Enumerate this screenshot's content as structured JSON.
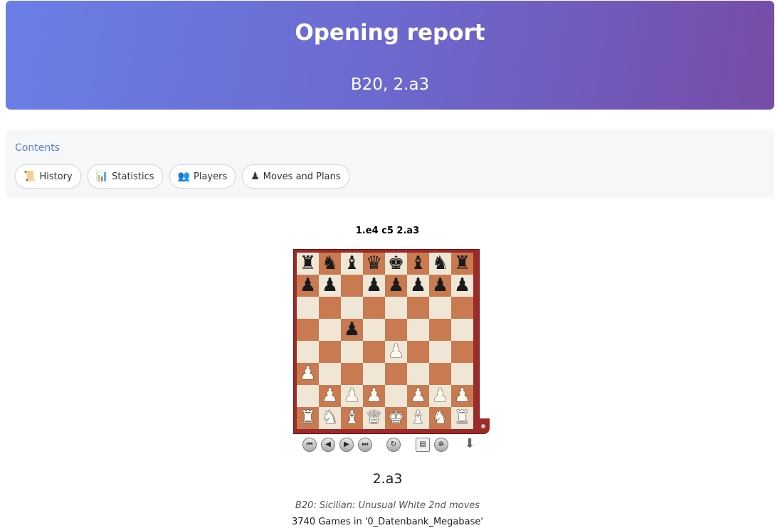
{
  "header": {
    "title": "Opening report",
    "subtitle": "B20, 2.a3"
  },
  "contents": {
    "title": "Contents",
    "tabs": [
      {
        "label": "History",
        "icon": "scroll-icon"
      },
      {
        "label": "Statistics",
        "icon": "chart-icon"
      },
      {
        "label": "Players",
        "icon": "players-icon"
      },
      {
        "label": "Moves and Plans",
        "icon": "pawn-icon"
      }
    ]
  },
  "board": {
    "caption": "1.e4 c5 2.a3",
    "ranks": [
      [
        "bR",
        "bN",
        "bB",
        "bQ",
        "bK",
        "bB",
        "bN",
        "bR"
      ],
      [
        "bP",
        "bP",
        "",
        "bP",
        "bP",
        "bP",
        "bP",
        "bP"
      ],
      [
        "",
        "",
        "",
        "",
        "",
        "",
        "",
        ""
      ],
      [
        "",
        "",
        "bP",
        "",
        "",
        "",
        "",
        ""
      ],
      [
        "",
        "",
        "",
        "",
        "wP",
        "",
        "",
        ""
      ],
      [
        "wP",
        "",
        "",
        "",
        "",
        "",
        "",
        ""
      ],
      [
        "",
        "wP",
        "wP",
        "wP",
        "",
        "wP",
        "wP",
        "wP"
      ],
      [
        "wR",
        "wN",
        "wB",
        "wQ",
        "wK",
        "wB",
        "wN",
        "wR"
      ]
    ],
    "controls": [
      "first-move-icon",
      "prev-move-icon",
      "next-move-icon",
      "last-move-icon",
      "flip-board-icon",
      "notation-icon",
      "engine-icon",
      "download-icon"
    ]
  },
  "move": {
    "title": "2.a3",
    "eco": "B20: Sicilian: Unusual White 2nd moves",
    "games": "3740 Games in '0_Datenbank_Megabase'"
  }
}
